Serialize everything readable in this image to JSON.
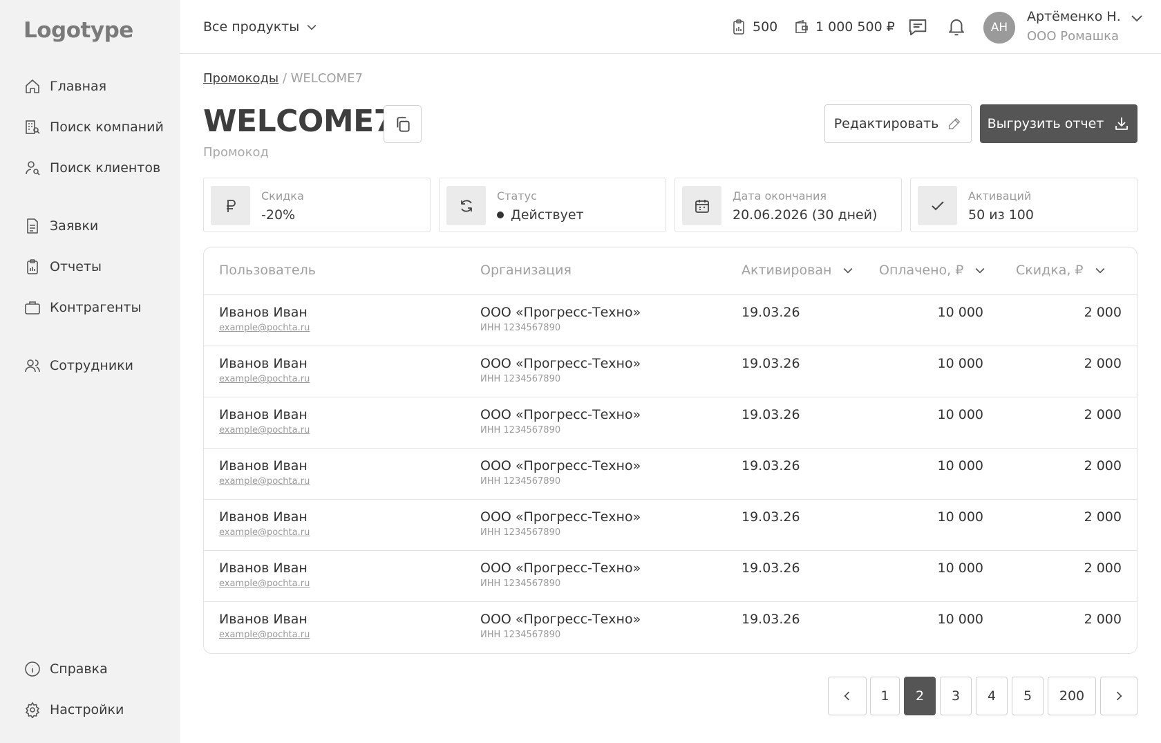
{
  "sidebar": {
    "logo": "Logotype",
    "items": [
      {
        "label": "Главная",
        "icon": "home-icon"
      },
      {
        "label": "Поиск компаний",
        "icon": "building-search-icon"
      },
      {
        "label": "Поиск клиентов",
        "icon": "user-search-icon"
      },
      {
        "label": "Заявки",
        "icon": "document-icon"
      },
      {
        "label": "Отчеты",
        "icon": "clipboard-chart-icon"
      },
      {
        "label": "Контрагенты",
        "icon": "briefcase-icon"
      },
      {
        "label": "Сотрудники",
        "icon": "users-icon"
      },
      {
        "label": "Справка",
        "icon": "info-icon"
      },
      {
        "label": "Настройки",
        "icon": "gear-icon"
      }
    ]
  },
  "header": {
    "product_select": "Все продукты",
    "reports_count": "500",
    "balance": "1 000 500 ₽",
    "avatar_initials": "АН",
    "user_name": "Артёменко Н.",
    "user_org": "ООО Ромашка"
  },
  "main": {
    "breadcrumb_parent": "Промокоды",
    "breadcrumb_separator": " / ",
    "breadcrumb_current": "WELCOME7",
    "title": "WELCOME7",
    "subtitle": "Промокод",
    "edit_label": "Редактировать",
    "export_label": "Выгрузить отчет"
  },
  "cards": [
    {
      "label": "Скидка",
      "value": "-20%",
      "icon": "ruble-icon"
    },
    {
      "label": "Статус",
      "value": "Действует",
      "icon": "refresh-icon"
    },
    {
      "label": "Дата окончания",
      "value": "20.06.2026 (30 дней)",
      "icon": "calendar-icon"
    },
    {
      "label": "Активаций",
      "value": "50 из 100",
      "icon": "check-icon"
    }
  ],
  "table": {
    "headers": [
      "Пользователь",
      "Организация",
      "Активирован",
      "Оплачено, ₽",
      "Скидка, ₽"
    ],
    "rows": [
      {
        "user": "Иванов Иван",
        "email": "example@pochta.ru",
        "org": "ООО «Прогресс-Техно»",
        "inn": "ИНН 1234567890",
        "date": "19.03.26",
        "paid": "10 000",
        "discount": "2 000"
      },
      {
        "user": "Иванов Иван",
        "email": "example@pochta.ru",
        "org": "ООО «Прогресс-Техно»",
        "inn": "ИНН 1234567890",
        "date": "19.03.26",
        "paid": "10 000",
        "discount": "2 000"
      },
      {
        "user": "Иванов Иван",
        "email": "example@pochta.ru",
        "org": "ООО «Прогресс-Техно»",
        "inn": "ИНН 1234567890",
        "date": "19.03.26",
        "paid": "10 000",
        "discount": "2 000"
      },
      {
        "user": "Иванов Иван",
        "email": "example@pochta.ru",
        "org": "ООО «Прогресс-Техно»",
        "inn": "ИНН 1234567890",
        "date": "19.03.26",
        "paid": "10 000",
        "discount": "2 000"
      },
      {
        "user": "Иванов Иван",
        "email": "example@pochta.ru",
        "org": "ООО «Прогресс-Техно»",
        "inn": "ИНН 1234567890",
        "date": "19.03.26",
        "paid": "10 000",
        "discount": "2 000"
      },
      {
        "user": "Иванов Иван",
        "email": "example@pochta.ru",
        "org": "ООО «Прогресс-Техно»",
        "inn": "ИНН 1234567890",
        "date": "19.03.26",
        "paid": "10 000",
        "discount": "2 000"
      },
      {
        "user": "Иванов Иван",
        "email": "example@pochta.ru",
        "org": "ООО «Прогресс-Техно»",
        "inn": "ИНН 1234567890",
        "date": "19.03.26",
        "paid": "10 000",
        "discount": "2 000"
      }
    ]
  },
  "pagination": {
    "pages": [
      "1",
      "2",
      "3",
      "4",
      "5",
      "200"
    ],
    "current": "2"
  }
}
